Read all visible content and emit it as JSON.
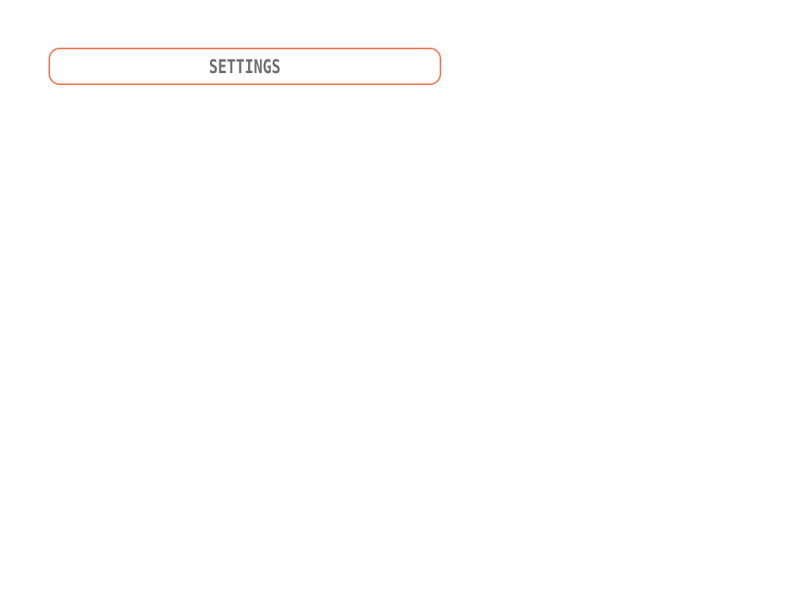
{
  "header": {
    "settings_label": "SETTINGS"
  },
  "colors": {
    "border_accent": "#ee7b5c",
    "label_text": "#6e6e6e",
    "background": "#ffffff"
  }
}
